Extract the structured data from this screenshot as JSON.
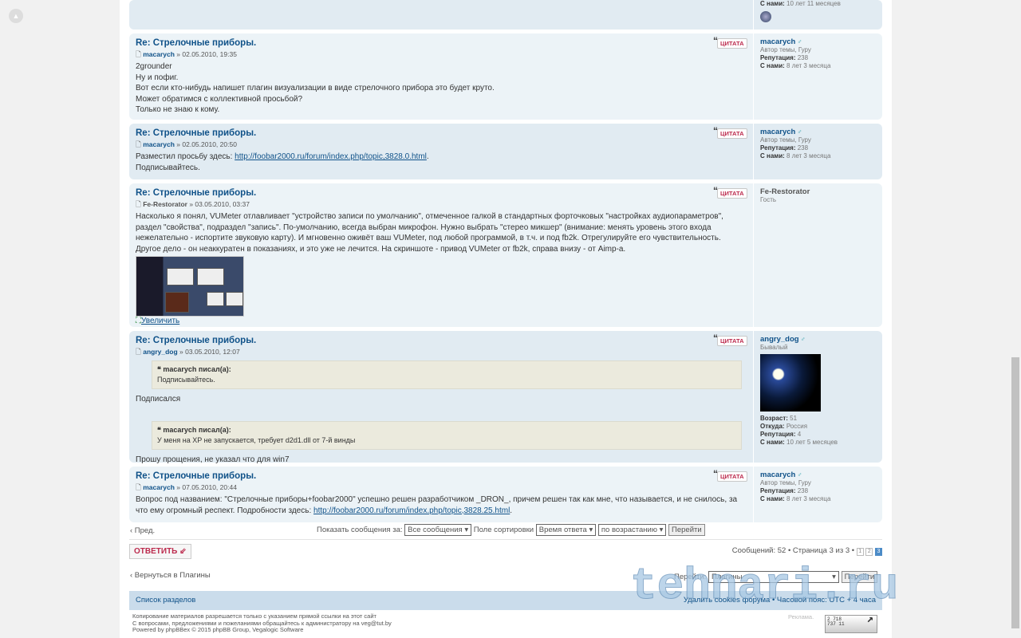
{
  "top_post": {
    "member_since_label": "С нами:",
    "member_since": "10 лет 11 месяцев"
  },
  "quote_label": "ЦИТАТА",
  "labels": {
    "reputation": "Репутация:",
    "since": "С нами:",
    "age": "Возраст:",
    "from": "Откуда:",
    "wrote": "писал(а):"
  },
  "posts": [
    {
      "title": "Re: Стрелочные приборы.",
      "author": "macarych",
      "date": "» 02.05.2010, 19:35",
      "lines": [
        "2grounder",
        "Ну и пофиг.",
        "Вот если кто-нибудь напишет плагин визуализации в виде стрелочного прибора это будет круто.",
        "Может обратимся с коллективной просьбой?",
        "Только не знаю к кому."
      ],
      "profile": {
        "name": "macarych",
        "rank": "Автор темы, Гуру",
        "reputation": "238",
        "since": "8 лет 3 месяца"
      }
    },
    {
      "title": "Re: Стрелочные приборы.",
      "author": "macarych",
      "date": "» 02.05.2010, 20:50",
      "text_before": "Разместил просьбу здесь: ",
      "link": "http://foobar2000.ru/forum/index.php/topic,3828.0.html",
      "text_after": ".",
      "line2": "Подписывайтесь.",
      "profile": {
        "name": "macarych",
        "rank": "Автор темы, Гуру",
        "reputation": "238",
        "since": "8 лет 3 месяца"
      }
    },
    {
      "title": "Re: Стрелочные приборы.",
      "author": "Fe-Restorator",
      "date": "» 03.05.2010, 03:37",
      "text": "Насколько я понял, VUMeter отлавливает \"устройство записи по умолчанию\", отмеченное галкой в стандартных форточковых \"настройках аудиопараметров\", раздел \"свойства\", подраздел \"запись\". По-умолчанию, всегда выбран микрофон. Нужно выбрать \"стерео микшер\" (внимание: менять уровень этого входа нежелательно - испортите звуковую карту). И мгновенно оживёт ваш VUMeter, под любой программой, в т.ч. и под fb2k. Отрегулируйте его чувствительность.",
      "line2": "Другое дело - он неаккуратен в показаниях, и это уже не лечится. На скриншоте - привод VUMeter от fb2k, справа внизу - от Aimp-a.",
      "enlarge": "Увеличить",
      "profile": {
        "name": "Fe-Restorator",
        "rank": "Гость"
      }
    },
    {
      "title": "Re: Стрелочные приборы.",
      "author": "angry_dog",
      "date": "» 03.05.2010, 12:07",
      "quote1": {
        "who": "macarych",
        "text": "Подписывайтесь."
      },
      "reply1": "Подписался",
      "quote2": {
        "who": "macarych",
        "text": "У меня на XP не запускается, требует d2d1.dll от 7-й винды"
      },
      "reply2": "Прошу прощения, не указал что для win7",
      "profile": {
        "name": "angry_dog",
        "rank": "Бывалый",
        "age": "51",
        "from": "Россия",
        "reputation": "4",
        "since": "10 лет 5 месяцев"
      }
    },
    {
      "title": "Re: Стрелочные приборы.",
      "author": "macarych",
      "date": "» 07.05.2010, 20:44",
      "text": "Вопрос под названием: \"Стрелочные приборы+foobar2000\" успешно решен разработчиком _DRON_, причем решен так как мне, что называется, и не снилось, за что ему огромный респект. Подробности здесь: ",
      "link": "http://foobar2000.ru/forum/index.php/topic,3828.25.html",
      "text_after": ".",
      "profile": {
        "name": "macarych",
        "rank": "Автор темы, Гуру",
        "reputation": "238",
        "since": "8 лет 3 месяца"
      }
    }
  ],
  "sortbar": {
    "prev": "‹ Пред.",
    "show_label": "Показать сообщения за:",
    "show_value": "Все сообщения",
    "sort_label": "Поле сортировки",
    "sort_value": "Время ответа",
    "order_value": "по возрастанию",
    "go": "Перейти"
  },
  "reply_button": "ОТВЕТИТЬ ⇙",
  "pagination": {
    "text": "Сообщений: 52 • Страница 3 из 3 •",
    "pages": [
      "1",
      "2",
      "3"
    ],
    "current": "3"
  },
  "back_link": "‹ Вернуться в Плагины",
  "jump": {
    "label": "Перейти:",
    "value": "Плагины",
    "go": "Перейти"
  },
  "footer": {
    "index": "Список разделов",
    "delete_cookies": "Удалить cookies форума",
    "timezone": "Часовой пояс: UTC + 4 часа",
    "ads": "Реклама.",
    "counter": "2 718 737 11"
  },
  "copyright": [
    "Копирование материалов разрешается только с указанием прямой ссылки на этот сайт",
    "С вопросами, предложениями и пожеланиями обращайтесь к администратору на veg@tut.by",
    "Powered by phpBBex © 2015 phpBB Group, Vegalogic Software"
  ],
  "watermark": "tehnari.ru",
  "colors": {
    "link": "#105289",
    "quote_button": "#bc2a4d",
    "post_bg_1": "#ecf3f7",
    "post_bg_2": "#e1ebf2",
    "footer_bar": "#cadceb"
  }
}
